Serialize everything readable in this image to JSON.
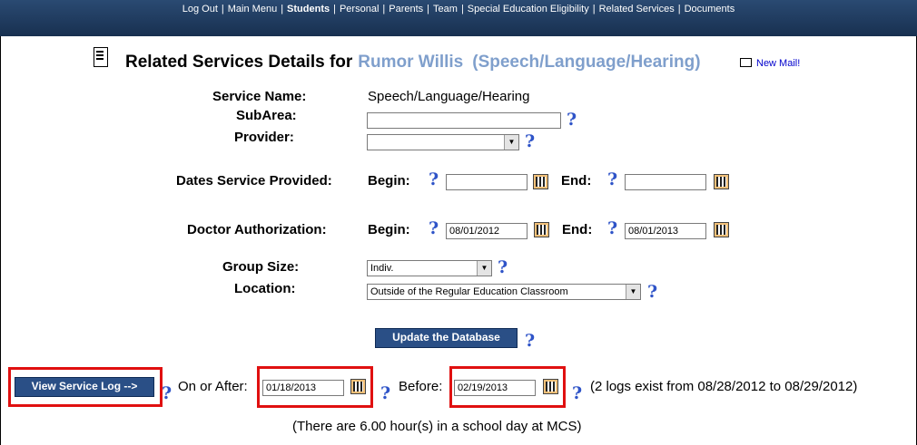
{
  "nav": {
    "items": [
      {
        "label": "Log Out",
        "current": false
      },
      {
        "label": "Main Menu",
        "current": false
      },
      {
        "label": "Students",
        "current": true
      },
      {
        "label": "Personal",
        "current": false
      },
      {
        "label": "Parents",
        "current": false
      },
      {
        "label": "Team",
        "current": false
      },
      {
        "label": "Special Education Eligibility",
        "current": false
      },
      {
        "label": "Related Services",
        "current": false
      },
      {
        "label": "Documents",
        "current": false
      }
    ]
  },
  "header": {
    "title": "Related Services Details for",
    "student_name": "Rumor Willis",
    "service_paren": "(Speech/Language/Hearing)",
    "mail_link": "New Mail!"
  },
  "form": {
    "service_name_label": "Service Name:",
    "service_name_value": "Speech/Language/Hearing",
    "subarea_label": "SubArea:",
    "subarea_value": "",
    "provider_label": "Provider:",
    "provider_value": "",
    "dates_label": "Dates Service Provided:",
    "begin_label": "Begin:",
    "end_label": "End:",
    "dates_begin_value": "",
    "dates_end_value": "",
    "doctor_label": "Doctor Authorization:",
    "doctor_begin_value": "08/01/2012",
    "doctor_end_value": "08/01/2013",
    "group_size_label": "Group Size:",
    "group_size_value": "Indiv.",
    "location_label": "Location:",
    "location_value": "Outside of the Regular Education Classroom",
    "update_button": "Update the Database"
  },
  "log": {
    "view_button": "View Service Log -->",
    "on_or_after_label": "On or After:",
    "on_or_after_value": "01/18/2013",
    "before_label": "Before:",
    "before_value": "02/19/2013",
    "summary": "(2 logs exist from 08/28/2012 to 08/29/2012)",
    "school_day_note": "(There are 6.00 hour(s) in a school day at MCS)"
  },
  "help_symbol": "?",
  "colors": {
    "nav_bg": "#1e3a5f",
    "accent_name": "#7f9fcc",
    "help_blue": "#2f54c8",
    "highlight_red": "#e01010",
    "button_bg": "#2a4f86"
  }
}
